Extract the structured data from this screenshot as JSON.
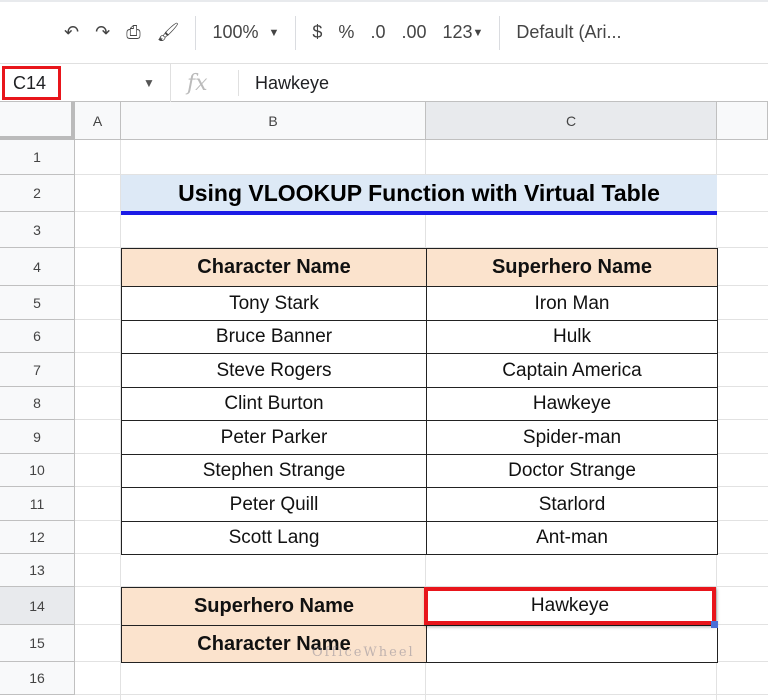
{
  "toolbar": {
    "zoom": "100%",
    "currency": "$",
    "percent": "%",
    "dec_decrease": ".0",
    "dec_increase": ".00",
    "format": "123",
    "font": "Default (Ari..."
  },
  "formula_bar": {
    "cell_ref": "C14",
    "fx": "fx",
    "value": "Hawkeye"
  },
  "columns": [
    "A",
    "B",
    "C"
  ],
  "rows": [
    "1",
    "2",
    "3",
    "4",
    "5",
    "6",
    "7",
    "8",
    "9",
    "10",
    "11",
    "12",
    "13",
    "14",
    "15",
    "16"
  ],
  "title": "Using VLOOKUP Function with Virtual Table",
  "table": {
    "headers": [
      "Character Name",
      "Superhero Name"
    ],
    "rows": [
      [
        "Tony Stark",
        "Iron Man"
      ],
      [
        "Bruce Banner",
        "Hulk"
      ],
      [
        "Steve Rogers",
        "Captain America"
      ],
      [
        "Clint Burton",
        "Hawkeye"
      ],
      [
        "Peter Parker",
        "Spider-man"
      ],
      [
        "Stephen Strange",
        "Doctor Strange"
      ],
      [
        "Peter Quill",
        "Starlord"
      ],
      [
        "Scott Lang",
        "Ant-man"
      ]
    ]
  },
  "lookup": {
    "label1": "Superhero Name",
    "value1": "Hawkeye",
    "label2": "Character Name",
    "value2": ""
  },
  "watermark": "OfficeWheel"
}
